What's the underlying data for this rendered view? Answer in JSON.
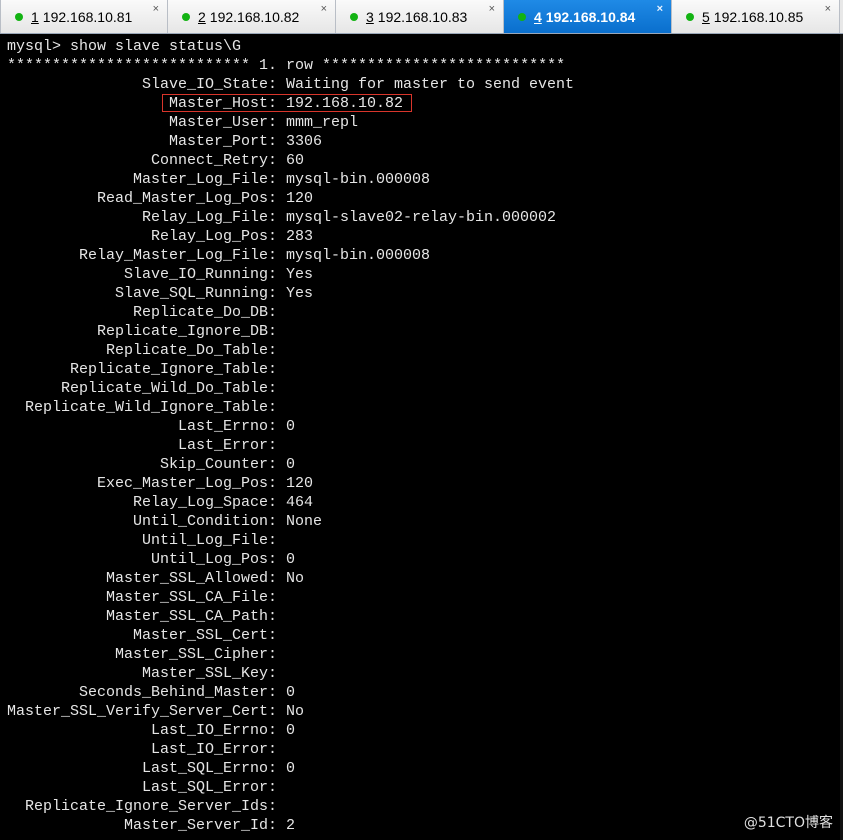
{
  "tabs": [
    {
      "number": "1",
      "label": "192.168.10.81",
      "close": "×",
      "active": false
    },
    {
      "number": "2",
      "label": "192.168.10.82",
      "close": "×",
      "active": false
    },
    {
      "number": "3",
      "label": "192.168.10.83",
      "close": "×",
      "active": false
    },
    {
      "number": "4",
      "label": "192.168.10.84",
      "close": "×",
      "active": true
    },
    {
      "number": "5",
      "label": "192.168.10.85",
      "close": "×",
      "active": false
    }
  ],
  "terminal": {
    "command": "mysql> show slave status\\G",
    "row_header": "*************************** 1. row ***************************",
    "rows": [
      {
        "key": "Slave_IO_State:",
        "value": "Waiting for master to send event"
      },
      {
        "key": "Master_Host:",
        "value": "192.168.10.82"
      },
      {
        "key": "Master_User:",
        "value": "mmm_repl"
      },
      {
        "key": "Master_Port:",
        "value": "3306"
      },
      {
        "key": "Connect_Retry:",
        "value": "60"
      },
      {
        "key": "Master_Log_File:",
        "value": "mysql-bin.000008"
      },
      {
        "key": "Read_Master_Log_Pos:",
        "value": "120"
      },
      {
        "key": "Relay_Log_File:",
        "value": "mysql-slave02-relay-bin.000002"
      },
      {
        "key": "Relay_Log_Pos:",
        "value": "283"
      },
      {
        "key": "Relay_Master_Log_File:",
        "value": "mysql-bin.000008"
      },
      {
        "key": "Slave_IO_Running:",
        "value": "Yes"
      },
      {
        "key": "Slave_SQL_Running:",
        "value": "Yes"
      },
      {
        "key": "Replicate_Do_DB:",
        "value": ""
      },
      {
        "key": "Replicate_Ignore_DB:",
        "value": ""
      },
      {
        "key": "Replicate_Do_Table:",
        "value": ""
      },
      {
        "key": "Replicate_Ignore_Table:",
        "value": ""
      },
      {
        "key": "Replicate_Wild_Do_Table:",
        "value": ""
      },
      {
        "key": "Replicate_Wild_Ignore_Table:",
        "value": ""
      },
      {
        "key": "Last_Errno:",
        "value": "0"
      },
      {
        "key": "Last_Error:",
        "value": ""
      },
      {
        "key": "Skip_Counter:",
        "value": "0"
      },
      {
        "key": "Exec_Master_Log_Pos:",
        "value": "120"
      },
      {
        "key": "Relay_Log_Space:",
        "value": "464"
      },
      {
        "key": "Until_Condition:",
        "value": "None"
      },
      {
        "key": "Until_Log_File:",
        "value": ""
      },
      {
        "key": "Until_Log_Pos:",
        "value": "0"
      },
      {
        "key": "Master_SSL_Allowed:",
        "value": "No"
      },
      {
        "key": "Master_SSL_CA_File:",
        "value": ""
      },
      {
        "key": "Master_SSL_CA_Path:",
        "value": ""
      },
      {
        "key": "Master_SSL_Cert:",
        "value": ""
      },
      {
        "key": "Master_SSL_Cipher:",
        "value": ""
      },
      {
        "key": "Master_SSL_Key:",
        "value": ""
      },
      {
        "key": "Seconds_Behind_Master:",
        "value": "0"
      },
      {
        "key": "Master_SSL_Verify_Server_Cert:",
        "value": "No"
      },
      {
        "key": "Last_IO_Errno:",
        "value": "0"
      },
      {
        "key": "Last_IO_Error:",
        "value": ""
      },
      {
        "key": "Last_SQL_Errno:",
        "value": "0"
      },
      {
        "key": "Last_SQL_Error:",
        "value": ""
      },
      {
        "key": "Replicate_Ignore_Server_Ids:",
        "value": ""
      },
      {
        "key": "Master_Server_Id:",
        "value": "2"
      }
    ]
  },
  "watermark": "@51CTO博客",
  "colors": {
    "terminal_bg": "#000000",
    "terminal_fg": "#e6e6e6",
    "active_tab": "#0a6fcd",
    "connected_dot": "#13b313",
    "highlight_box": "#d9352b"
  }
}
